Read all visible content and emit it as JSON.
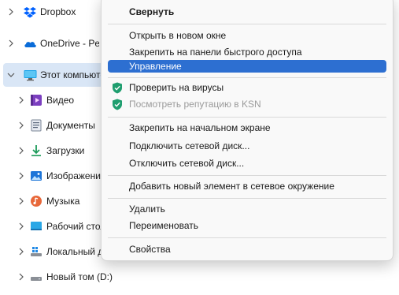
{
  "nav": {
    "items": [
      {
        "label": "Dropbox",
        "icon": "dropbox-icon"
      },
      {
        "label": "OneDrive - Personal",
        "icon": "onedrive-icon"
      },
      {
        "label": "Этот компьютер",
        "icon": "computer-icon"
      },
      {
        "label": "Видео",
        "icon": "video-icon"
      },
      {
        "label": "Документы",
        "icon": "documents-icon"
      },
      {
        "label": "Загрузки",
        "icon": "downloads-icon"
      },
      {
        "label": "Изображения",
        "icon": "pictures-icon"
      },
      {
        "label": "Музыка",
        "icon": "music-icon"
      },
      {
        "label": "Рабочий стол",
        "icon": "desktop-icon"
      },
      {
        "label": "Локальный диск (C:)",
        "icon": "drive-icon"
      },
      {
        "label": "Новый том (D:)",
        "icon": "drive-icon"
      }
    ]
  },
  "menu": {
    "collapse": "Свернуть",
    "open_new_window": "Открыть в новом окне",
    "pin_quick_access": "Закрепить на панели быстрого доступа",
    "manage": "Управление",
    "scan_viruses": "Проверить на вирусы",
    "check_ksn": "Посмотреть репутацию в KSN",
    "pin_start": "Закрепить на начальном экране",
    "map_drive": "Подключить сетевой диск...",
    "disconnect_drive": "Отключить сетевой диск...",
    "add_network_location": "Добавить новый элемент в сетевое окружение",
    "delete": "Удалить",
    "rename": "Переименовать",
    "properties": "Свойства"
  },
  "colors": {
    "highlight": "#2d6fd1",
    "selected_nav": "#d9e6f6",
    "shield": "#1f9e6f"
  }
}
